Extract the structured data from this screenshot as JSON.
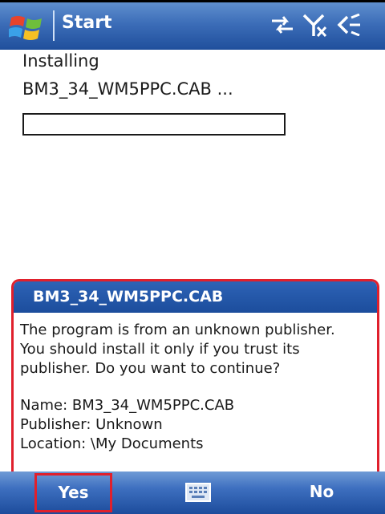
{
  "titlebar": {
    "title": "Start",
    "status_icons": [
      "connectivity-icon",
      "signal-off-icon",
      "speaker-icon"
    ]
  },
  "install": {
    "line1": "Installing",
    "line2": "BM3_34_WM5PPC.CAB ...",
    "progress": 0
  },
  "dialog": {
    "title": "BM3_34_WM5PPC.CAB",
    "message_lines": [
      "The program is from an unknown publisher.",
      "You should install it only if you trust its",
      "publisher. Do you want to continue?"
    ],
    "details_lines": [
      "Name: BM3_34_WM5PPC.CAB",
      "Publisher: Unknown",
      "Location: \\My Documents"
    ]
  },
  "softkeys": {
    "left": "Yes",
    "right": "No",
    "center_icon": "keyboard-icon"
  },
  "colors": {
    "accent_blue": "#1f4f9c",
    "highlight_red": "#e0202c"
  }
}
